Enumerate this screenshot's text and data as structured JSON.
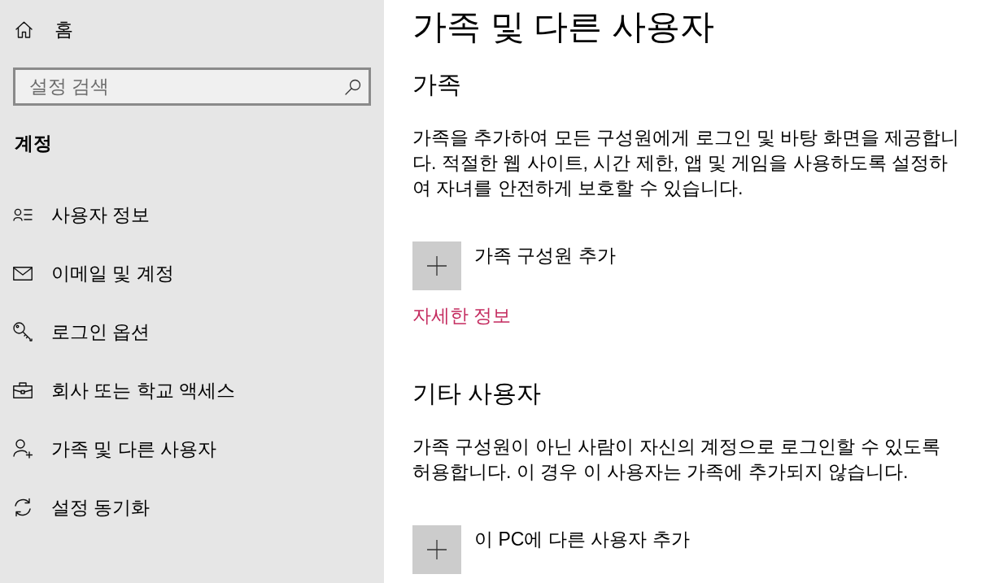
{
  "sidebar": {
    "home": {
      "label": "홈"
    },
    "search": {
      "placeholder": "설정 검색"
    },
    "section_title": "계정",
    "items": [
      {
        "label": "사용자 정보"
      },
      {
        "label": "이메일 및 계정"
      },
      {
        "label": "로그인 옵션"
      },
      {
        "label": "회사 또는 학교 액세스"
      },
      {
        "label": "가족 및 다른 사용자"
      },
      {
        "label": "설정 동기화"
      }
    ]
  },
  "page": {
    "title": "가족 및 다른 사용자",
    "sections": [
      {
        "heading": "가족",
        "description": "가족을 추가하여 모든 구성원에게 로그인 및 바탕 화면을 제공합니다. 적절한 웹 사이트, 시간 제한, 앱 및 게임을 사용하도록 설정하여 자녀를 안전하게 보호할 수 있습니다.",
        "add_button": {
          "label": "가족 구성원 추가"
        },
        "link": "자세한 정보"
      },
      {
        "heading": "기타 사용자",
        "description": "가족 구성원이 아닌 사람이 자신의 계정으로 로그인할 수 있도록 허용합니다. 이 경우 이 사용자는 가족에 추가되지 않습니다.",
        "add_button": {
          "label": "이 PC에 다른 사용자 추가"
        }
      }
    ]
  }
}
